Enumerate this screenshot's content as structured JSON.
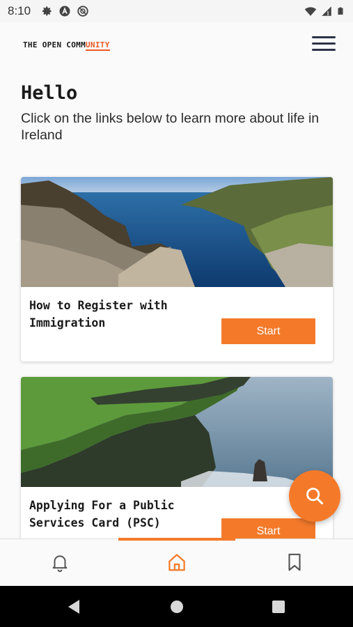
{
  "status_bar": {
    "time": "8:10",
    "left_icons": [
      "gear-icon",
      "app-a-icon",
      "do-not-disturb-icon"
    ],
    "right_icons": [
      "wifi-icon",
      "signal-icon",
      "battery-icon"
    ]
  },
  "header": {
    "logo_text_main": "THE OPEN COMM",
    "logo_text_accent": "UNITY",
    "menu_icon": "hamburger-menu-icon"
  },
  "main": {
    "greeting": "Hello",
    "subtitle": "Click on the links below to learn more about life in Ireland"
  },
  "cards": [
    {
      "title": "How to Register with Immigration",
      "button_label": "Start",
      "image": "sea-cliffs-image"
    },
    {
      "title": "Applying For a Public Services Card (PSC)",
      "button_label": "Start",
      "image": "cliffs-of-moher-image"
    }
  ],
  "fab": {
    "icon": "search-icon"
  },
  "bottom_nav": {
    "items": [
      {
        "name": "notifications",
        "icon": "bell-icon",
        "active": false
      },
      {
        "name": "home",
        "icon": "home-icon",
        "active": true
      },
      {
        "name": "saved",
        "icon": "bookmark-icon",
        "active": false
      }
    ]
  },
  "colors": {
    "accent": "#f47a2a",
    "logo_accent": "#ee5a24",
    "text_dark": "#1a1a1a",
    "menu_icon": "#2c3347"
  }
}
